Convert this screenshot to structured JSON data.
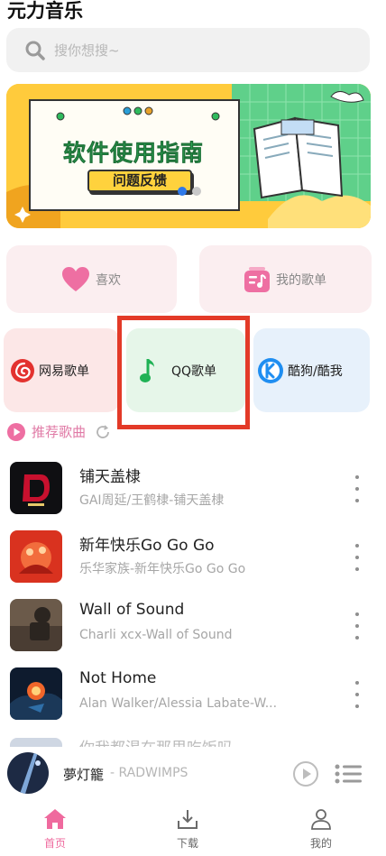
{
  "app": {
    "title": "元力音乐"
  },
  "search": {
    "placeholder": "搜你想搜~"
  },
  "banner": {
    "title": "软件使用指南",
    "button": "问题反馈",
    "slide_count": 2,
    "active_slide": 1
  },
  "quick": {
    "like": "喜欢",
    "playlist": "我的歌单"
  },
  "sources": {
    "netease": "网易歌单",
    "qq": "QQ歌单",
    "kugou": "酷狗/酷我"
  },
  "section": {
    "recommend": "推荐歌曲"
  },
  "songs": [
    {
      "title": "铺天盖棣",
      "subtitle": "GAI周延/王鹤棣-铺天盖棣"
    },
    {
      "title": "新年快乐Go Go Go",
      "subtitle": "乐华家族-新年快乐Go Go Go"
    },
    {
      "title": "Wall of Sound",
      "subtitle": "Charli xcx-Wall of Sound"
    },
    {
      "title": "Not Home",
      "subtitle": "Alan Walker/Alessia Labate-W..."
    }
  ],
  "partial_song": {
    "title": "你我都渴在那里吃饭吗"
  },
  "player": {
    "title": "夢灯籠",
    "artist": "- RADWIMPS"
  },
  "tabs": {
    "home": "首页",
    "download": "下载",
    "mine": "我的"
  },
  "colors": {
    "accent": "#ef6a9e",
    "highlight": "#e33a28"
  }
}
